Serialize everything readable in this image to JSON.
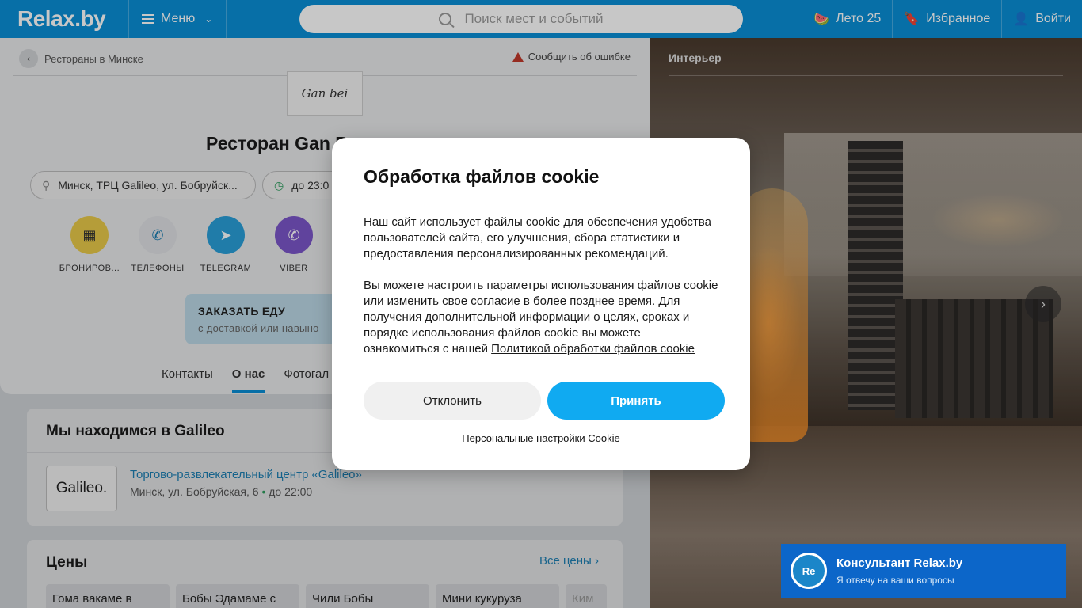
{
  "header": {
    "logo": "Relax.by",
    "menu_label": "Меню",
    "search_placeholder": "Поиск мест и событий",
    "summer_label": "Лето 25",
    "favorites_label": "Избранное",
    "login_label": "Войти",
    "color": "#0a8fd6"
  },
  "page": {
    "breadcrumb": "Рестораны в Минске",
    "report_error": "Сообщить об ошибке",
    "logo_text": "Gan bei",
    "title": "Ресторан Gan B",
    "address": "Минск, ТРЦ Galileo, ул. Бобруйск...",
    "hours": "до 23:0",
    "actions": [
      {
        "label": "БРОНИРОВ...",
        "icon": "calendar-icon",
        "color": "#e8c94a"
      },
      {
        "label": "ТЕЛЕФОНЫ",
        "icon": "phone-icon",
        "color": "#dfe1e4"
      },
      {
        "label": "TELEGRAM",
        "icon": "telegram-icon",
        "color": "#2a9fd9"
      },
      {
        "label": "VIBER",
        "icon": "viber-icon",
        "color": "#7b57c9"
      }
    ],
    "order": {
      "title": "ЗАКАЗАТЬ ЕДУ",
      "subtitle": "с доставкой или навыно"
    },
    "tabs": [
      "Контакты",
      "О нас",
      "Фотогал"
    ],
    "location": {
      "heading": "Мы находимся в Galileo",
      "logo_text": "Galileo.",
      "name": "Торгово-развлекательный центр «Galileo»",
      "address": "Минск, ул. Бобруйская, 6",
      "dot": " • ",
      "hours": "до 22:00"
    },
    "prices": {
      "heading": "Цены",
      "all_link": "Все цены",
      "items": [
        "Гома вакаме в",
        "Бобы Эдамаме с",
        "Чили Бобы",
        "Мини кукуруза",
        "Ким"
      ]
    }
  },
  "photo": {
    "label": "Интерьер"
  },
  "consultant": {
    "avatar": "Re",
    "title": "Консультант Relax.by",
    "subtitle": "Я отвечу на ваши вопросы"
  },
  "cookie": {
    "title": "Обработка файлов cookie",
    "para1": "Наш сайт использует файлы cookie для обеспечения удобства пользователей сайта, его улучшения, сбора статистики и предоставления персонализированных рекомендаций.",
    "para2": "Вы можете настроить параметры использования файлов cookie или изменить свое согласие в более позднее время. Для получения дополнительной информации о целях, сроках и порядке использования файлов cookie вы можете ознакомиться с нашей ",
    "policy_link": "Политикой обработки файлов cookie",
    "decline": "Отклонить",
    "accept": "Принять",
    "settings": "Персональные настройки Cookie",
    "accent": "#10aaf1"
  }
}
